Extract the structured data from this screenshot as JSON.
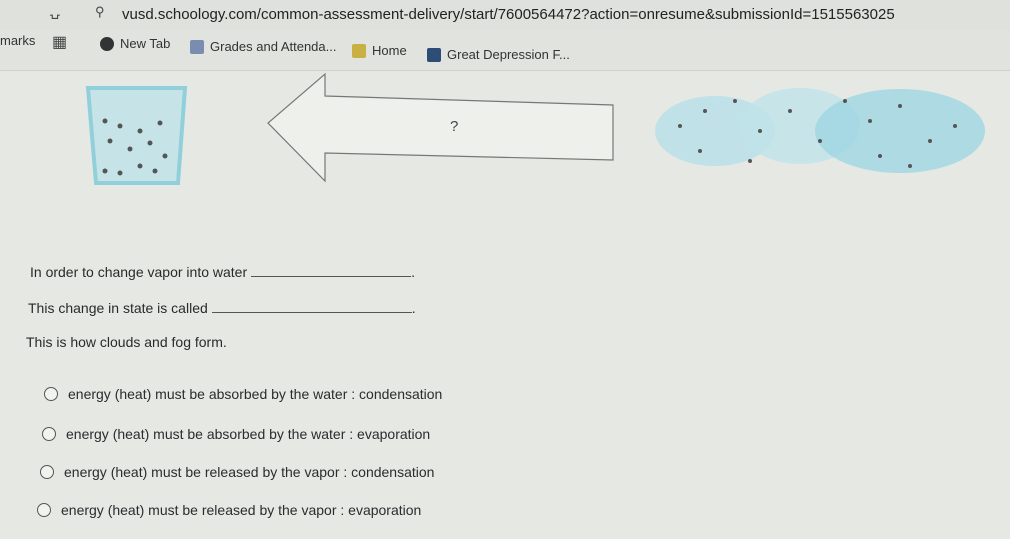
{
  "browser": {
    "url": "vusd.schoology.com/common-assessment-delivery/start/7600564472?action=onresume&submissionId=1515563025",
    "bookmarks_label": "marks",
    "bookmarks": [
      {
        "label": "New Tab",
        "icon": "globe-icon"
      },
      {
        "label": "Grades and Attenda...",
        "icon": "grades-icon"
      },
      {
        "label": "Home",
        "icon": "classroom-icon"
      },
      {
        "label": "Great Depression F...",
        "icon": "site-icon"
      }
    ]
  },
  "diagram": {
    "arrow_label": "?"
  },
  "question": {
    "line1": "In order to change vapor into water",
    "line2": "This change in state is called",
    "line3": "This is how clouds and fog form.",
    "options": [
      "energy (heat) must be absorbed by the water : condensation",
      "energy (heat) must be absorbed by the water : evaporation",
      "energy (heat) must be released by the vapor : condensation",
      "energy (heat) must be released by the vapor : evaporation"
    ]
  },
  "colors": {
    "water": "#6fc6d8",
    "molecule": "#555555"
  }
}
